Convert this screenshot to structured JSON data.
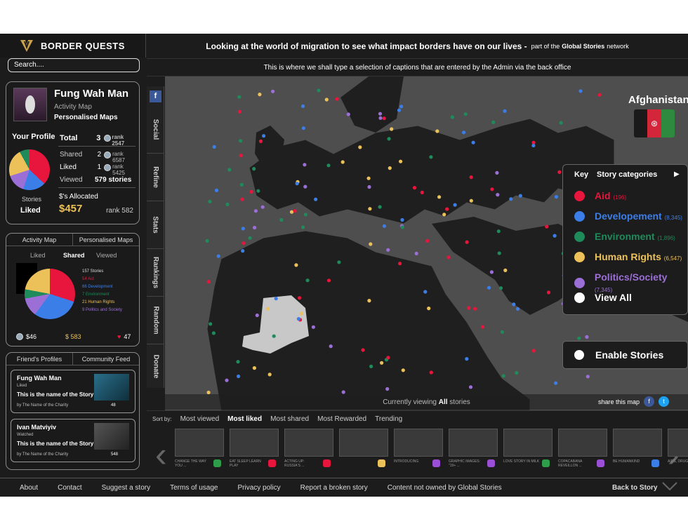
{
  "header": {
    "brand": "BORDER QUESTS",
    "headline": "Looking at the world of migration to see what impact borders have on our lives -",
    "network_pre": "part of the",
    "network_name": "Global Stories",
    "network_post": "network",
    "caption": "This is where we shall type a selection of captions that are entered by the Admin via the back office"
  },
  "search": {
    "placeholder": "Search...."
  },
  "profile": {
    "name": "Fung Wah Man",
    "link1": "Activity Map",
    "link2": "Personalised Maps",
    "your_profile": "Your Profile",
    "total_label": "Total",
    "total_value": "3",
    "total_rank": "rank 2547",
    "shared_label": "Shared",
    "shared_value": "2",
    "shared_rank": "rank 6587",
    "liked_label": "Liked",
    "liked_value": "1",
    "liked_rank": "rank 5425",
    "viewed_label": "Viewed",
    "viewed_value": "579 stories",
    "stories_label": "Stories",
    "stories_value": "Liked",
    "allocated_label": "$'s Allocated",
    "allocated_value": "$457",
    "allocated_rank": "rank 582"
  },
  "activity": {
    "tabs": [
      "Activity Map",
      "Personalised Maps"
    ],
    "subtabs": [
      "Liked",
      "Shared",
      "Viewed"
    ],
    "legend": [
      "157 Stories",
      "54 Aid",
      "66 Development",
      "7 Environment",
      "21 Human Rights",
      "9 Politics and Society"
    ],
    "coins": "$46",
    "dollars": "$ 583",
    "hearts": "47"
  },
  "social": {
    "tabs": [
      "Friend's Profiles",
      "Community Feed"
    ],
    "cards": [
      {
        "name": "Fung Wah Man",
        "action": "Liked",
        "title": "This is the name of the Story",
        "by": "by The Name of the Charity",
        "count": "48"
      },
      {
        "name": "Ivan Matviyiv",
        "action": "Watched",
        "title": "This is the name of the Story",
        "by": "by The Name of the Charity",
        "count": "548"
      }
    ]
  },
  "sidebar_tabs": [
    "Social",
    "Refine",
    "Stats",
    "Rankings",
    "Random",
    "Donate"
  ],
  "country": {
    "name": "Afghanistan",
    "flag_colors": [
      "#1a1a1a",
      "#d3263a",
      "#2e8a3e"
    ]
  },
  "key": {
    "title": "Key",
    "subtitle": "Story categories",
    "items": [
      {
        "label": "Aid",
        "count": "(196)",
        "color": "#e8163c"
      },
      {
        "label": "Developement",
        "count": "(8,345)",
        "color": "#3c7ee8"
      },
      {
        "label": "Environment",
        "count": "(1,896)",
        "color": "#1f8a5a"
      },
      {
        "label": "Human Rights",
        "count": "(6,547)",
        "color": "#ecc15a"
      },
      {
        "label": "Politics/Society",
        "count": "(7,345)",
        "color": "#9b6fd6"
      },
      {
        "label": "View All",
        "count": "",
        "color": "#ffffff"
      }
    ]
  },
  "enable": "Enable Stories",
  "viewing": {
    "pre": "Currently viewing",
    "strong": "All",
    "post": "stories"
  },
  "share": "share this map",
  "sort": {
    "label": "Sort by:",
    "options": [
      "Most viewed",
      "Most liked",
      "Most shared",
      "Most Rewarded",
      "Trending"
    ],
    "active": "Most liked"
  },
  "tiles": [
    {
      "title": "CHANGE THE WAY YOU ...",
      "icon": "#2e9e4a"
    },
    {
      "title": "EAT SLEEP LEARN PLAY",
      "icon": "#e8163c"
    },
    {
      "title": "ACTING UP: RUSSIA'S ...",
      "icon": "#e8163c"
    },
    {
      "title": "",
      "icon": "#ecc15a"
    },
    {
      "title": "INTRODUCING",
      "icon": "#9b4fd6"
    },
    {
      "title": "GRAPHIC IMAGES: \"19+ ...",
      "icon": "#9b4fd6"
    },
    {
      "title": "LOVE STORY IN MILK",
      "icon": "#2e9e4a"
    },
    {
      "title": "COPACABANA REVEILLON ...",
      "icon": "#9b4fd6"
    },
    {
      "title": "BE HUMANKIND",
      "icon": "#3c7ee8"
    },
    {
      "title": "AIDS, DRUGS AND ...",
      "icon": "#3c7ee8"
    }
  ],
  "footer": {
    "links": [
      "About",
      "Contact",
      "Suggest a story",
      "Terms of usage",
      "Privacy policy",
      "Report a broken story",
      "Content not owned by Global Stories"
    ],
    "back": "Back to Story"
  }
}
